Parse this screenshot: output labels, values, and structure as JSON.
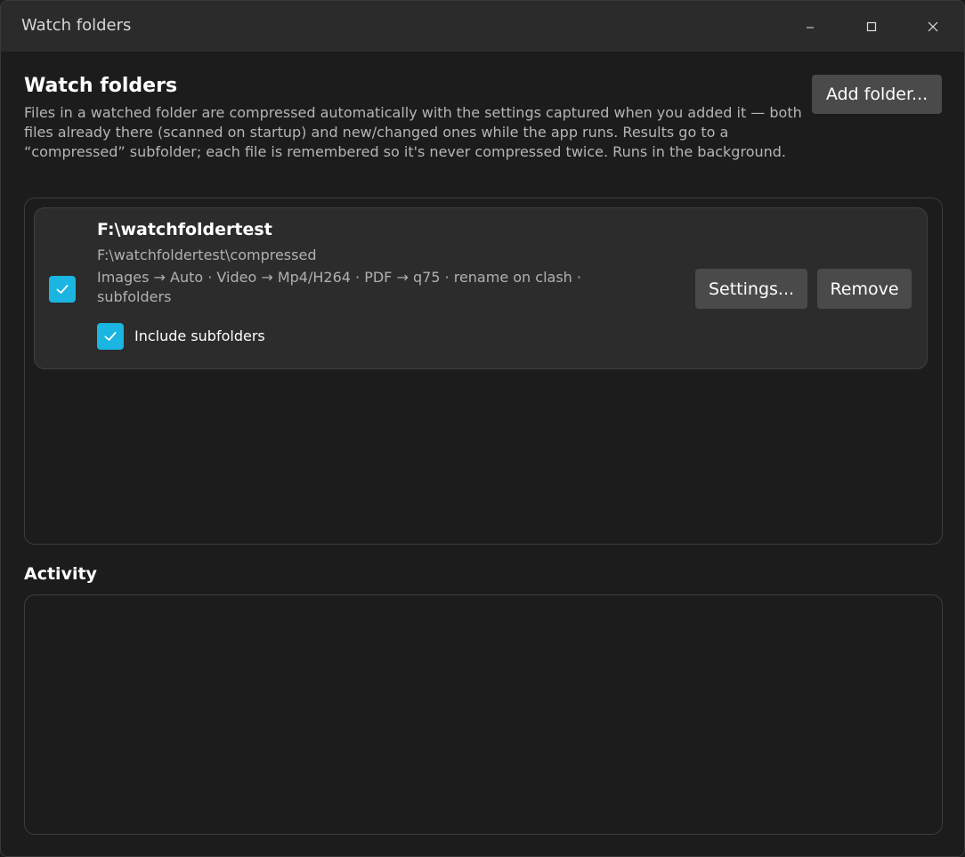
{
  "window": {
    "title": "Watch folders",
    "controls": [
      "minimize-icon",
      "maximize-icon",
      "close-icon"
    ]
  },
  "header": {
    "title": "Watch folders",
    "description": "Files in a watched folder are compressed automatically with the settings captured when you added it — both files already there (scanned on startup) and new/changed ones while the app runs. Results go to a “compressed” subfolder; each file is remembered so it's never compressed twice. Runs in the background.",
    "add_button": "Add folder..."
  },
  "folders": [
    {
      "enabled": true,
      "path": "F:\\watchfoldertest",
      "output": "F:\\watchfoldertest\\compressed",
      "summary": "Images → Auto · Video → Mp4/H264 · PDF → q75 · rename on clash · subfolders",
      "include_subfolders": true,
      "include_subfolders_label": "Include subfolders",
      "settings_button": "Settings...",
      "remove_button": "Remove"
    }
  ],
  "activity": {
    "title": "Activity",
    "entries": []
  },
  "colors": {
    "accent": "#1ab5e0",
    "background": "#1c1c1c",
    "titlebar": "#2b2b2b",
    "card": "#2c2c2c",
    "button": "#4a4a4a"
  }
}
